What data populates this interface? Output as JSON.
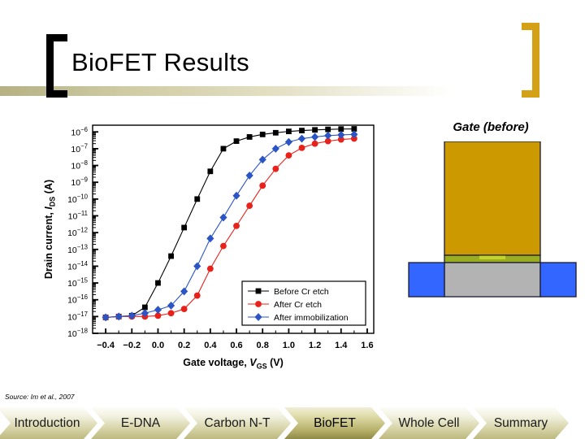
{
  "slide": {
    "title": "BioFET Results",
    "source_note": "Source: Im et al., 2007",
    "accent_gold": "#d4a017",
    "bracket_left_color": "#000000"
  },
  "device_diagram": {
    "label": "Gate (before)",
    "gate_color": "#cc9900",
    "oxide_color": "#9aad1e",
    "channel_color": "#b3b3b3",
    "contact_color": "#3366ff",
    "outline_color": "#1a1a33",
    "parts": [
      {
        "name": "gate",
        "label": "Gate (before)",
        "color": "#cc9900"
      },
      {
        "name": "oxide",
        "label": "",
        "color": "#9aad1e"
      },
      {
        "name": "channel",
        "label": "",
        "color": "#b3b3b3"
      },
      {
        "name": "source-contact",
        "label": "",
        "color": "#3366ff"
      },
      {
        "name": "drain-contact",
        "label": "",
        "color": "#3366ff"
      }
    ]
  },
  "chart_data": {
    "type": "line",
    "title": "",
    "xlabel": "Gate voltage, V_GS (V)",
    "xlabel_parts": {
      "lead": "Gate voltage, ",
      "italic": "V",
      "sub": "GS",
      "tail": " (V)"
    },
    "ylabel": "Drain current, I_DS (A)",
    "ylabel_parts": {
      "lead": "Drain current, ",
      "italic": "I",
      "sub": "DS",
      "tail": " (A)"
    },
    "xlim": [
      -0.5,
      1.65
    ],
    "ylim_log10": [
      -18,
      -5.6
    ],
    "xticks": [
      -0.4,
      -0.2,
      0.0,
      0.2,
      0.4,
      0.6,
      0.8,
      1.0,
      1.2,
      1.4,
      1.6
    ],
    "xticklabels": [
      "−0.4",
      "−0.2",
      "0.0",
      "0.2",
      "0.4",
      "0.6",
      "0.8",
      "1.0",
      "1.2",
      "1.4",
      "1.6"
    ],
    "yticks_log10": [
      -6,
      -7,
      -8,
      -9,
      -10,
      -11,
      -12,
      -13,
      -14,
      -15,
      -16,
      -17,
      -18
    ],
    "yticklabels": [
      "10−6",
      "10−7",
      "10−8",
      "10−9",
      "10−10",
      "10−11",
      "10−12",
      "10−13",
      "10−14",
      "10−15",
      "10−16",
      "10−17",
      "10−18"
    ],
    "grid": false,
    "legend_position": "lower-right",
    "series": [
      {
        "name": "Before Cr etch",
        "color": "#000000",
        "marker": "square",
        "x": [
          -0.4,
          -0.3,
          -0.2,
          -0.1,
          0.0,
          0.1,
          0.2,
          0.3,
          0.4,
          0.5,
          0.6,
          0.7,
          0.8,
          0.9,
          1.0,
          1.1,
          1.2,
          1.3,
          1.4,
          1.5
        ],
        "y_log10": [
          -17.05,
          -17.0,
          -16.95,
          -16.45,
          -15.0,
          -13.4,
          -11.7,
          -10.0,
          -8.35,
          -7.0,
          -6.55,
          -6.3,
          -6.15,
          -6.05,
          -5.97,
          -5.92,
          -5.88,
          -5.85,
          -5.83,
          -5.82
        ]
      },
      {
        "name": "After Cr etch",
        "color": "#e8211a",
        "marker": "circle",
        "x": [
          -0.4,
          -0.3,
          -0.2,
          -0.1,
          0.0,
          0.1,
          0.2,
          0.3,
          0.4,
          0.5,
          0.6,
          0.7,
          0.8,
          0.9,
          1.0,
          1.1,
          1.2,
          1.3,
          1.4,
          1.5
        ],
        "y_log10": [
          -17.05,
          -17.0,
          -17.0,
          -17.0,
          -16.95,
          -16.8,
          -16.55,
          -15.75,
          -14.15,
          -12.8,
          -11.6,
          -10.4,
          -9.2,
          -8.2,
          -7.4,
          -6.95,
          -6.7,
          -6.55,
          -6.45,
          -6.4
        ]
      },
      {
        "name": "After immobilization",
        "color": "#2b55c4",
        "marker": "diamond",
        "x": [
          -0.4,
          -0.3,
          -0.2,
          -0.1,
          0.0,
          0.1,
          0.2,
          0.3,
          0.4,
          0.5,
          0.6,
          0.7,
          0.8,
          0.9,
          1.0,
          1.1,
          1.2,
          1.3,
          1.4,
          1.5
        ],
        "y_log10": [
          -17.05,
          -17.0,
          -16.95,
          -16.8,
          -16.6,
          -16.35,
          -15.5,
          -14.0,
          -12.35,
          -11.1,
          -9.8,
          -8.6,
          -7.65,
          -7.0,
          -6.6,
          -6.4,
          -6.3,
          -6.22,
          -6.18,
          -6.15
        ]
      }
    ]
  },
  "nav": {
    "tabs": [
      {
        "label": "Introduction",
        "active": false
      },
      {
        "label": "E-DNA",
        "active": false
      },
      {
        "label": "Carbon N-T",
        "active": false
      },
      {
        "label": "BioFET",
        "active": true
      },
      {
        "label": "Whole Cell",
        "active": false
      },
      {
        "label": "Summary",
        "active": false
      }
    ]
  }
}
